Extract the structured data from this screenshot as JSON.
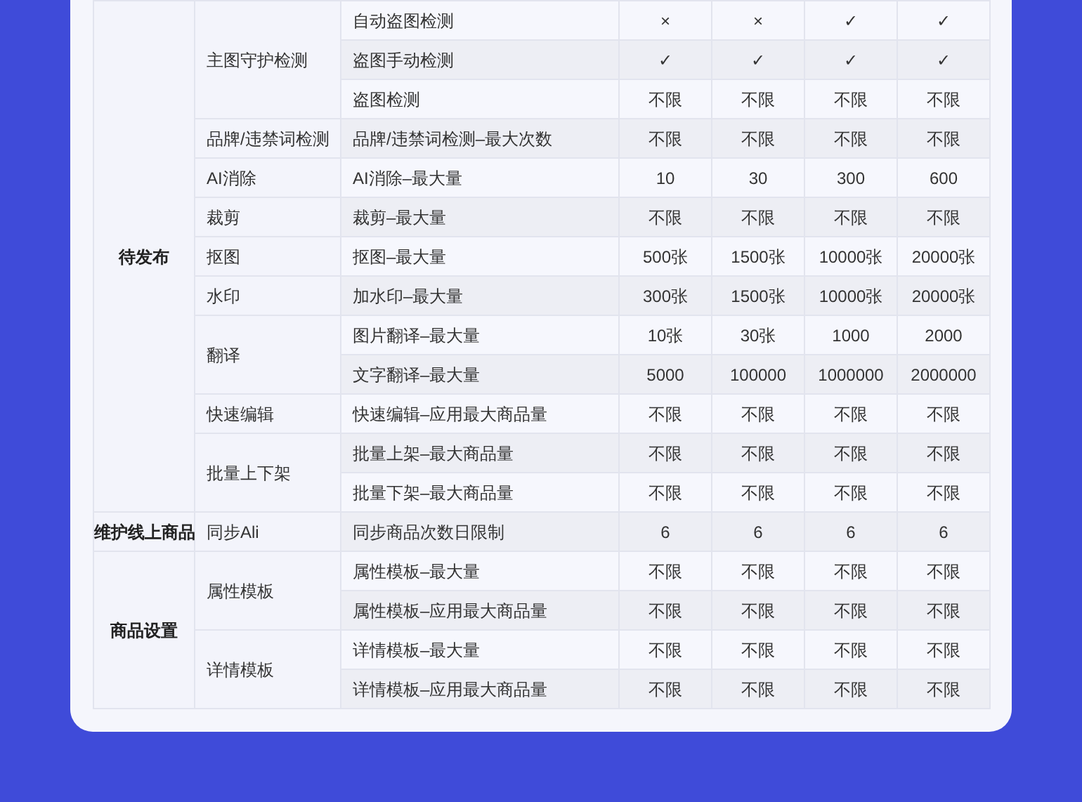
{
  "groups": [
    {
      "label": "待发布",
      "features": [
        {
          "label": "主图守护检测",
          "items": [
            {
              "label": "自动盗图检测",
              "values": [
                "×",
                "×",
                "✓",
                "✓"
              ]
            },
            {
              "label": "盗图手动检测",
              "values": [
                "✓",
                "✓",
                "✓",
                "✓"
              ]
            },
            {
              "label": "盗图检测",
              "values": [
                "不限",
                "不限",
                "不限",
                "不限"
              ]
            }
          ]
        },
        {
          "label": "品牌/违禁词检测",
          "items": [
            {
              "label": "品牌/违禁词检测–最大次数",
              "values": [
                "不限",
                "不限",
                "不限",
                "不限"
              ]
            }
          ]
        },
        {
          "label": "AI消除",
          "items": [
            {
              "label": "AI消除–最大量",
              "values": [
                "10",
                "30",
                "300",
                "600"
              ]
            }
          ]
        },
        {
          "label": "裁剪",
          "items": [
            {
              "label": "裁剪–最大量",
              "values": [
                "不限",
                "不限",
                "不限",
                "不限"
              ]
            }
          ]
        },
        {
          "label": "抠图",
          "items": [
            {
              "label": "抠图–最大量",
              "values": [
                "500张",
                "1500张",
                "10000张",
                "20000张"
              ]
            }
          ]
        },
        {
          "label": "水印",
          "items": [
            {
              "label": "加水印–最大量",
              "values": [
                "300张",
                "1500张",
                "10000张",
                "20000张"
              ]
            }
          ]
        },
        {
          "label": "翻译",
          "items": [
            {
              "label": "图片翻译–最大量",
              "values": [
                "10张",
                "30张",
                "1000",
                "2000"
              ]
            },
            {
              "label": "文字翻译–最大量",
              "values": [
                "5000",
                "100000",
                "1000000",
                "2000000"
              ]
            }
          ]
        },
        {
          "label": "快速编辑",
          "items": [
            {
              "label": "快速编辑–应用最大商品量",
              "values": [
                "不限",
                "不限",
                "不限",
                "不限"
              ]
            }
          ]
        },
        {
          "label": "批量上下架",
          "items": [
            {
              "label": "批量上架–最大商品量",
              "values": [
                "不限",
                "不限",
                "不限",
                "不限"
              ]
            },
            {
              "label": "批量下架–最大商品量",
              "values": [
                "不限",
                "不限",
                "不限",
                "不限"
              ]
            }
          ]
        }
      ]
    },
    {
      "label": "维护线上商品",
      "features": [
        {
          "label": "同步Ali",
          "items": [
            {
              "label": "同步商品次数日限制",
              "values": [
                "6",
                "6",
                "6",
                "6"
              ]
            }
          ]
        }
      ]
    },
    {
      "label": "商品设置",
      "features": [
        {
          "label": "属性模板",
          "items": [
            {
              "label": "属性模板–最大量",
              "values": [
                "不限",
                "不限",
                "不限",
                "不限"
              ]
            },
            {
              "label": "属性模板–应用最大商品量",
              "values": [
                "不限",
                "不限",
                "不限",
                "不限"
              ]
            }
          ]
        },
        {
          "label": "详情模板",
          "items": [
            {
              "label": "详情模板–最大量",
              "values": [
                "不限",
                "不限",
                "不限",
                "不限"
              ]
            },
            {
              "label": "详情模板–应用最大商品量",
              "values": [
                "不限",
                "不限",
                "不限",
                "不限"
              ]
            }
          ]
        }
      ]
    }
  ]
}
